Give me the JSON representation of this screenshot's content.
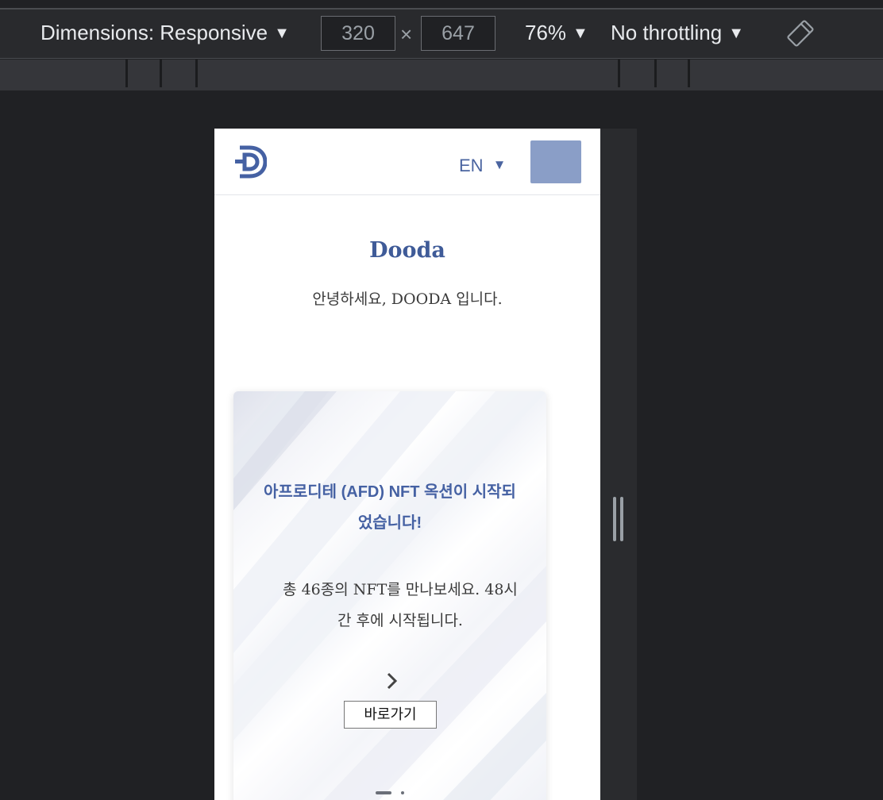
{
  "devtools": {
    "dimensions_label": "Dimensions: Responsive",
    "width_value": "320",
    "times_sign": "×",
    "height_value": "647",
    "zoom": "76%",
    "throttling": "No throttling",
    "caret": "▼"
  },
  "site": {
    "language": "EN",
    "language_caret": "▼",
    "brand": "Dooda",
    "intro": "안녕하세요, DOODA 입니다.",
    "menu_button_color": "#8a9ec7",
    "accent_color": "#4561a3"
  },
  "card": {
    "title": "아프로디테 (AFD) NFT 옥션이 시작되었습니다!",
    "description": "총 46종의 NFT를 만나보세요. 48시간 후에 시작됩니다.",
    "button_label": "바로가기",
    "slides_total": 2,
    "slide_active": 1
  }
}
